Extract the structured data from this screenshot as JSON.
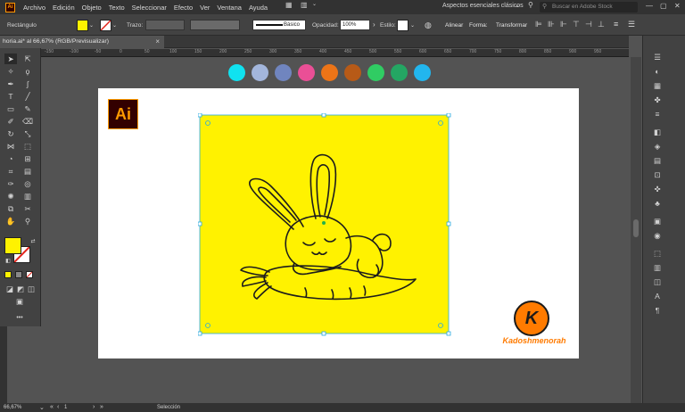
{
  "menubar": {
    "app_icon": "Ai",
    "items": [
      "Archivo",
      "Edición",
      "Objeto",
      "Texto",
      "Seleccionar",
      "Efecto",
      "Ver",
      "Ventana",
      "Ayuda"
    ],
    "workspace": "Aspectos esenciales clásicos",
    "stock_search_placeholder": "Buscar en Adobe Stock"
  },
  "control_bar": {
    "selection_label": "Rectángulo",
    "fill_color": "#fff200",
    "stroke_label": "Trazo:",
    "brush_label": "Básico",
    "opacity_label": "Opacidad:",
    "opacity_value": "100%",
    "style_label": "Estilo:",
    "align_label": "Alinear",
    "shape_label": "Forma:",
    "transform_label": "Transformar"
  },
  "document_tab": {
    "title": "horia.ai* al 66,67% (RGB/Previsualizar)",
    "close": "×"
  },
  "ruler_marks": [
    "-150",
    "-100",
    "-50",
    "0",
    "50",
    "100",
    "150",
    "200",
    "250",
    "300",
    "350",
    "400",
    "450",
    "500",
    "550",
    "600",
    "650",
    "700",
    "750",
    "800",
    "850",
    "900",
    "950"
  ],
  "palette": [
    "#10e2f0",
    "#a3b6dc",
    "#7085bf",
    "#ea4f96",
    "#ec7417",
    "#b75a17",
    "#30cc63",
    "#24a663",
    "#22b6ee"
  ],
  "artwork": {
    "background": "#fff200",
    "logo_text": "Ai",
    "brand_initial": "K",
    "brand_name": "Kadoshmenorah",
    "brand_color": "#ff7b00"
  },
  "toolbar": {
    "fill": "#fff200",
    "more": "•••"
  },
  "status": {
    "zoom": "66,67%",
    "page": "1",
    "tool": "Selección"
  }
}
